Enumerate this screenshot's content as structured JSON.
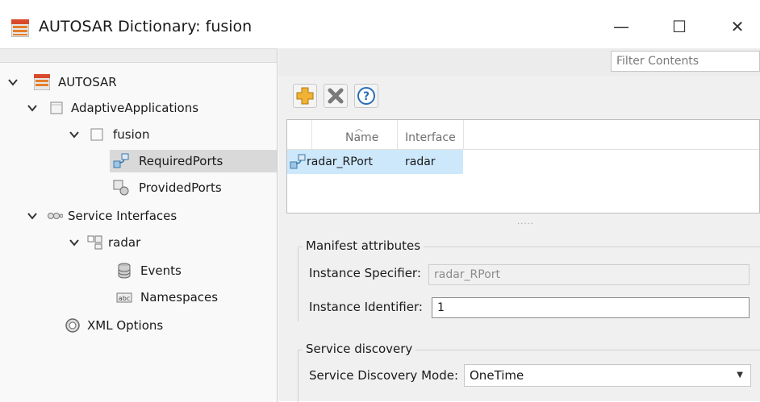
{
  "window": {
    "title": "AUTOSAR Dictionary: fusion",
    "minimize_glyph": "—",
    "maximize_glyph": "☐",
    "close_glyph": "✕"
  },
  "tree": {
    "root": "AUTOSAR",
    "adaptive_applications": "AdaptiveApplications",
    "fusion": "fusion",
    "required_ports": "RequiredPorts",
    "provided_ports": "ProvidedPorts",
    "service_interfaces": "Service Interfaces",
    "radar": "radar",
    "events": "Events",
    "namespaces": "Namespaces",
    "xml_options": "XML Options"
  },
  "filter": {
    "placeholder": "Filter Contents"
  },
  "table": {
    "columns": [
      "Name",
      "Interface"
    ],
    "rows": [
      {
        "name": "radar_RPort",
        "interface": "radar"
      }
    ]
  },
  "manifest": {
    "legend": "Manifest attributes",
    "instance_specifier_label": "Instance Specifier:",
    "instance_specifier_value": "radar_RPort",
    "instance_identifier_label": "Instance Identifier:",
    "instance_identifier_value": "1"
  },
  "discovery": {
    "legend": "Service discovery",
    "mode_label": "Service Discovery Mode:",
    "mode_value": "OneTime"
  },
  "icons": {
    "add": "add-icon",
    "delete": "delete-icon",
    "help": "help-icon"
  },
  "colors": {
    "selection_row": "#cde8fb",
    "tree_selected": "#d9d9d9",
    "add_icon": "#f2b233",
    "help_icon": "#2a6fb5"
  }
}
